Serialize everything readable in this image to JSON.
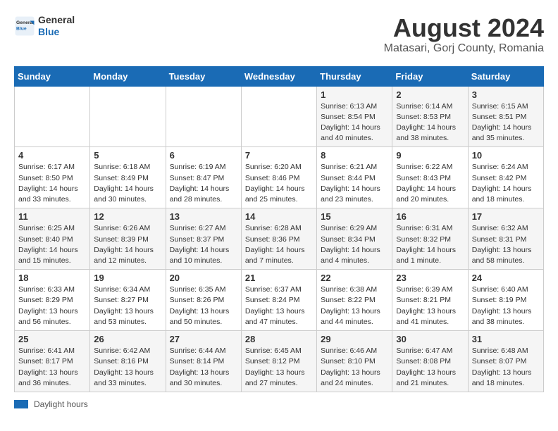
{
  "header": {
    "logo_general": "General",
    "logo_blue": "Blue",
    "month_title": "August 2024",
    "subtitle": "Matasari, Gorj County, Romania"
  },
  "days_of_week": [
    "Sunday",
    "Monday",
    "Tuesday",
    "Wednesday",
    "Thursday",
    "Friday",
    "Saturday"
  ],
  "legend": {
    "label": "Daylight hours"
  },
  "weeks": [
    [
      {
        "day": "",
        "info": ""
      },
      {
        "day": "",
        "info": ""
      },
      {
        "day": "",
        "info": ""
      },
      {
        "day": "",
        "info": ""
      },
      {
        "day": "1",
        "info": "Sunrise: 6:13 AM\nSunset: 8:54 PM\nDaylight: 14 hours\nand 40 minutes."
      },
      {
        "day": "2",
        "info": "Sunrise: 6:14 AM\nSunset: 8:53 PM\nDaylight: 14 hours\nand 38 minutes."
      },
      {
        "day": "3",
        "info": "Sunrise: 6:15 AM\nSunset: 8:51 PM\nDaylight: 14 hours\nand 35 minutes."
      }
    ],
    [
      {
        "day": "4",
        "info": "Sunrise: 6:17 AM\nSunset: 8:50 PM\nDaylight: 14 hours\nand 33 minutes."
      },
      {
        "day": "5",
        "info": "Sunrise: 6:18 AM\nSunset: 8:49 PM\nDaylight: 14 hours\nand 30 minutes."
      },
      {
        "day": "6",
        "info": "Sunrise: 6:19 AM\nSunset: 8:47 PM\nDaylight: 14 hours\nand 28 minutes."
      },
      {
        "day": "7",
        "info": "Sunrise: 6:20 AM\nSunset: 8:46 PM\nDaylight: 14 hours\nand 25 minutes."
      },
      {
        "day": "8",
        "info": "Sunrise: 6:21 AM\nSunset: 8:44 PM\nDaylight: 14 hours\nand 23 minutes."
      },
      {
        "day": "9",
        "info": "Sunrise: 6:22 AM\nSunset: 8:43 PM\nDaylight: 14 hours\nand 20 minutes."
      },
      {
        "day": "10",
        "info": "Sunrise: 6:24 AM\nSunset: 8:42 PM\nDaylight: 14 hours\nand 18 minutes."
      }
    ],
    [
      {
        "day": "11",
        "info": "Sunrise: 6:25 AM\nSunset: 8:40 PM\nDaylight: 14 hours\nand 15 minutes."
      },
      {
        "day": "12",
        "info": "Sunrise: 6:26 AM\nSunset: 8:39 PM\nDaylight: 14 hours\nand 12 minutes."
      },
      {
        "day": "13",
        "info": "Sunrise: 6:27 AM\nSunset: 8:37 PM\nDaylight: 14 hours\nand 10 minutes."
      },
      {
        "day": "14",
        "info": "Sunrise: 6:28 AM\nSunset: 8:36 PM\nDaylight: 14 hours\nand 7 minutes."
      },
      {
        "day": "15",
        "info": "Sunrise: 6:29 AM\nSunset: 8:34 PM\nDaylight: 14 hours\nand 4 minutes."
      },
      {
        "day": "16",
        "info": "Sunrise: 6:31 AM\nSunset: 8:32 PM\nDaylight: 14 hours\nand 1 minute."
      },
      {
        "day": "17",
        "info": "Sunrise: 6:32 AM\nSunset: 8:31 PM\nDaylight: 13 hours\nand 58 minutes."
      }
    ],
    [
      {
        "day": "18",
        "info": "Sunrise: 6:33 AM\nSunset: 8:29 PM\nDaylight: 13 hours\nand 56 minutes."
      },
      {
        "day": "19",
        "info": "Sunrise: 6:34 AM\nSunset: 8:27 PM\nDaylight: 13 hours\nand 53 minutes."
      },
      {
        "day": "20",
        "info": "Sunrise: 6:35 AM\nSunset: 8:26 PM\nDaylight: 13 hours\nand 50 minutes."
      },
      {
        "day": "21",
        "info": "Sunrise: 6:37 AM\nSunset: 8:24 PM\nDaylight: 13 hours\nand 47 minutes."
      },
      {
        "day": "22",
        "info": "Sunrise: 6:38 AM\nSunset: 8:22 PM\nDaylight: 13 hours\nand 44 minutes."
      },
      {
        "day": "23",
        "info": "Sunrise: 6:39 AM\nSunset: 8:21 PM\nDaylight: 13 hours\nand 41 minutes."
      },
      {
        "day": "24",
        "info": "Sunrise: 6:40 AM\nSunset: 8:19 PM\nDaylight: 13 hours\nand 38 minutes."
      }
    ],
    [
      {
        "day": "25",
        "info": "Sunrise: 6:41 AM\nSunset: 8:17 PM\nDaylight: 13 hours\nand 36 minutes."
      },
      {
        "day": "26",
        "info": "Sunrise: 6:42 AM\nSunset: 8:16 PM\nDaylight: 13 hours\nand 33 minutes."
      },
      {
        "day": "27",
        "info": "Sunrise: 6:44 AM\nSunset: 8:14 PM\nDaylight: 13 hours\nand 30 minutes."
      },
      {
        "day": "28",
        "info": "Sunrise: 6:45 AM\nSunset: 8:12 PM\nDaylight: 13 hours\nand 27 minutes."
      },
      {
        "day": "29",
        "info": "Sunrise: 6:46 AM\nSunset: 8:10 PM\nDaylight: 13 hours\nand 24 minutes."
      },
      {
        "day": "30",
        "info": "Sunrise: 6:47 AM\nSunset: 8:08 PM\nDaylight: 13 hours\nand 21 minutes."
      },
      {
        "day": "31",
        "info": "Sunrise: 6:48 AM\nSunset: 8:07 PM\nDaylight: 13 hours\nand 18 minutes."
      }
    ]
  ]
}
